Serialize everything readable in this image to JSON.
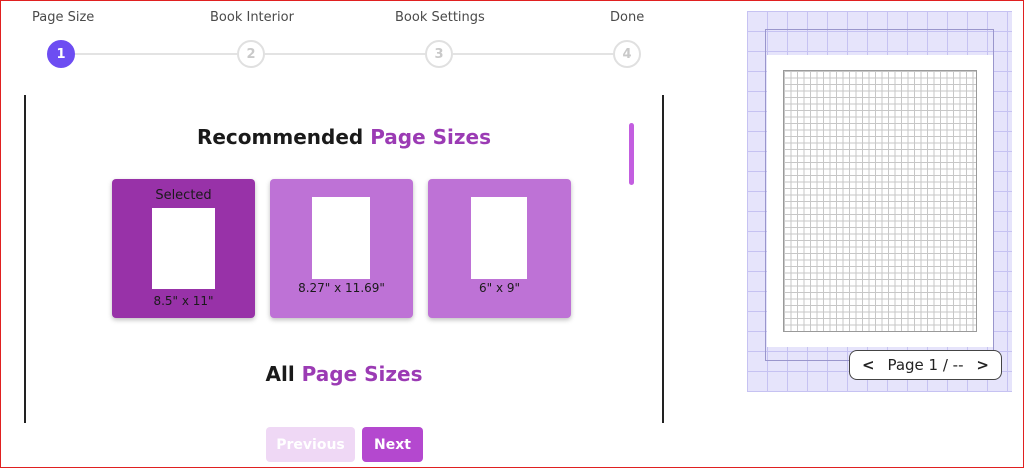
{
  "stepper": {
    "steps": [
      {
        "label": "Page Size",
        "number": "1"
      },
      {
        "label": "Book Interior",
        "number": "2"
      },
      {
        "label": "Book Settings",
        "number": "3"
      },
      {
        "label": "Done",
        "number": "4"
      }
    ],
    "active_step": 1
  },
  "main": {
    "recommended_heading_prefix": "Recommended",
    "recommended_heading_accent": "Page Sizes",
    "all_heading_prefix": "All",
    "all_heading_accent": "Page Sizes",
    "cards": [
      {
        "top_label": "Selected",
        "size": "8.5\" x 11\"",
        "selected": true
      },
      {
        "top_label": "",
        "size": "8.27\" x 11.69\"",
        "selected": false
      },
      {
        "top_label": "",
        "size": "6\" x 9\"",
        "selected": false
      }
    ]
  },
  "buttons": {
    "previous": "Previous",
    "next": "Next"
  },
  "preview": {
    "pager_prev_icon": "<",
    "pager_text": "Page 1 / --",
    "pager_next_icon": ">"
  },
  "colors": {
    "step_active": "#6d4df2",
    "accent_text": "#9b3bb4",
    "card_selected": "#9832a8",
    "card_default": "#be72d6",
    "next_button": "#b448cf",
    "previous_button_disabled": "#efd8f5"
  }
}
